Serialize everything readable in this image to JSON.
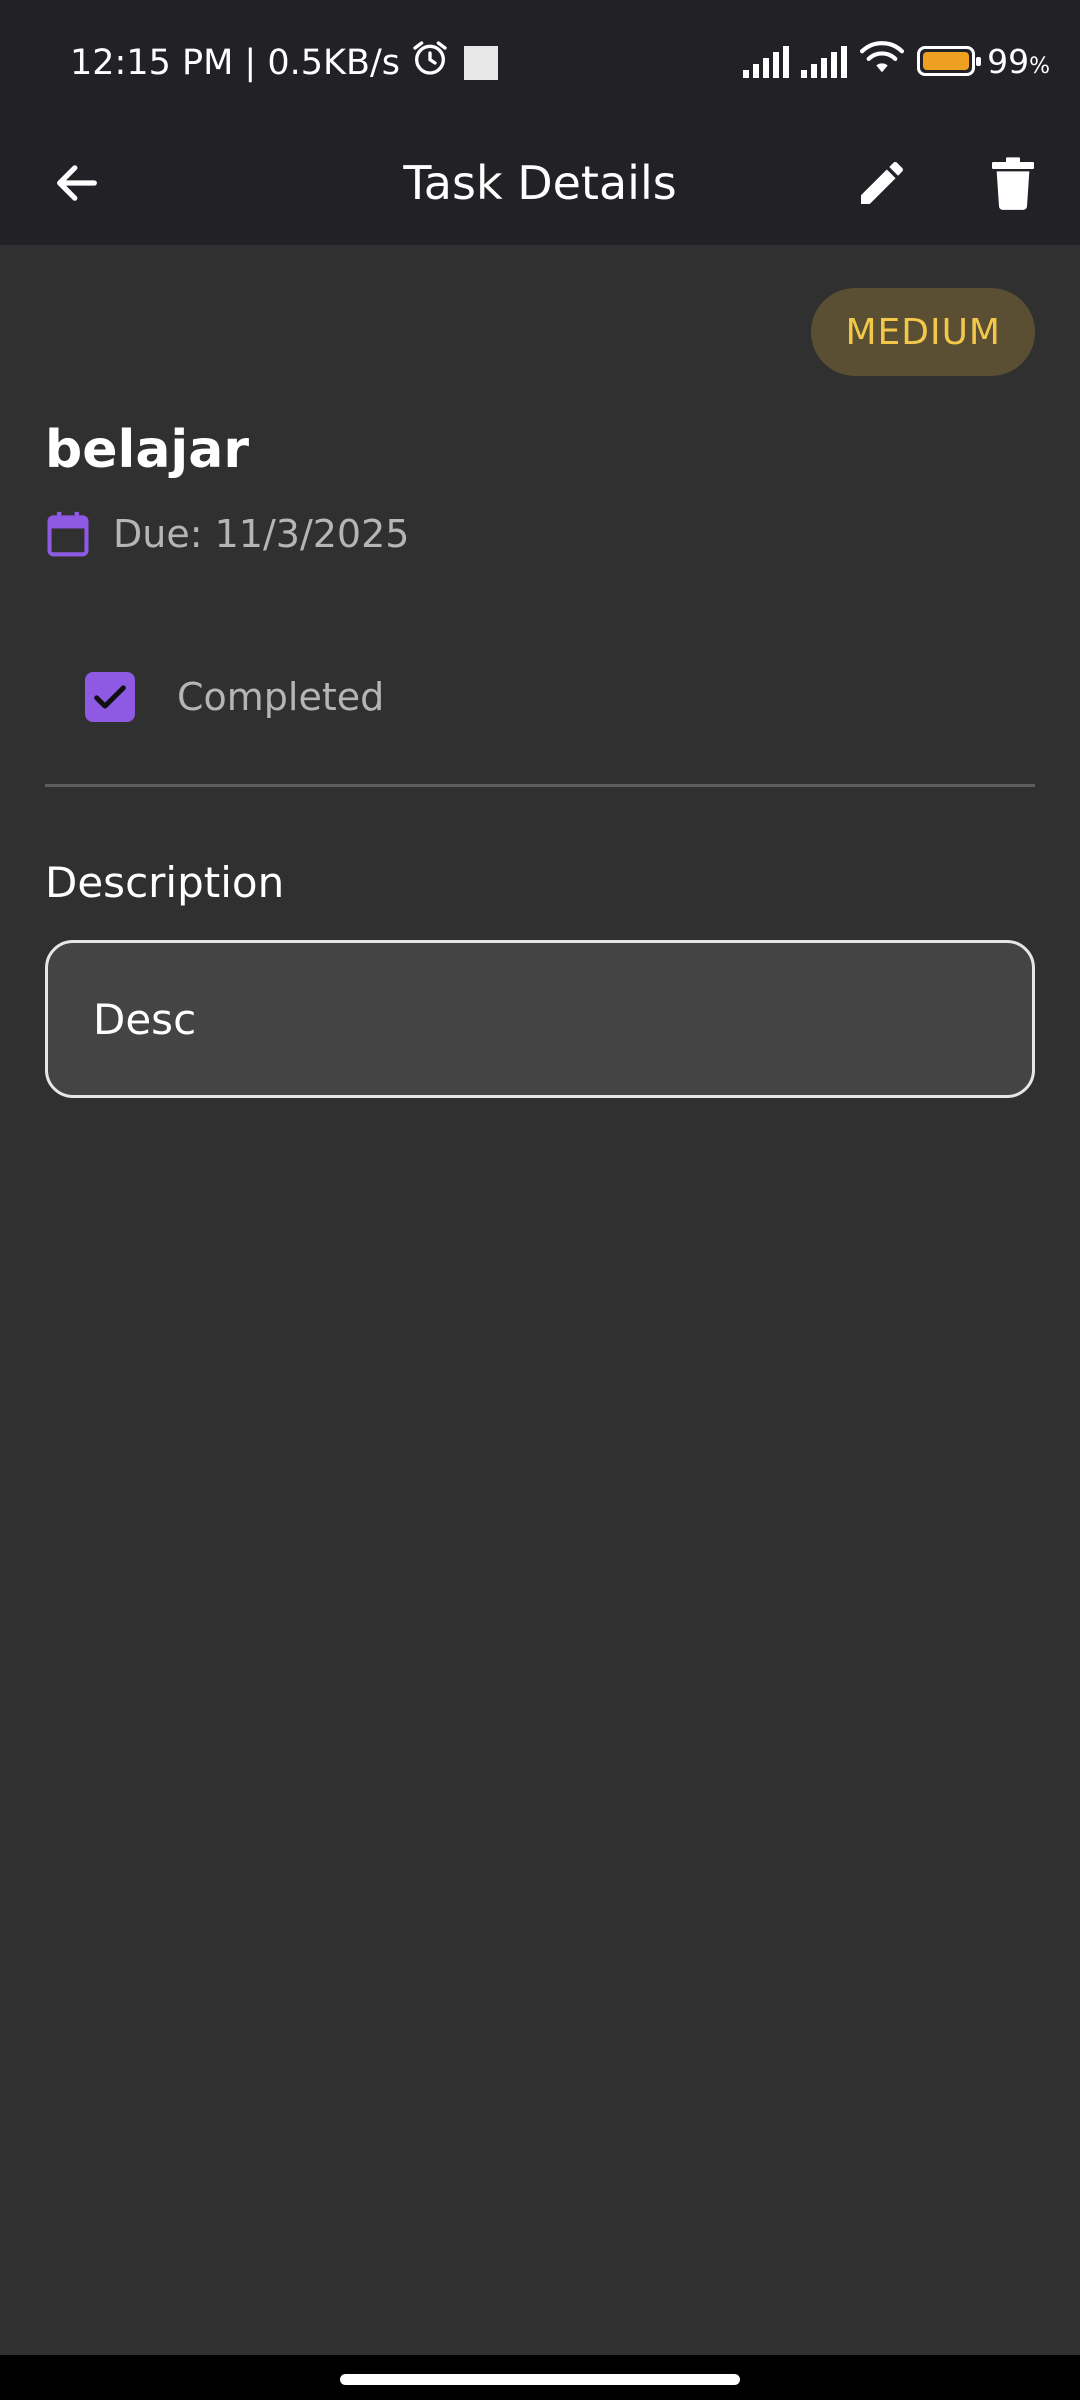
{
  "status_bar": {
    "time_speed": "12:15 PM | 0.5KB/s",
    "battery_percent": "99",
    "battery_pct_sign": "%",
    "battery_color": "#f0a020",
    "icons": [
      "alarm-icon",
      "stop-square-icon",
      "signal-icon",
      "signal-icon",
      "wifi-icon",
      "battery-icon"
    ]
  },
  "app_bar": {
    "title": "Task Details",
    "back_icon": "arrow-left-icon",
    "edit_icon": "pencil-icon",
    "delete_icon": "trash-icon"
  },
  "task": {
    "priority": "MEDIUM",
    "priority_color": "#f3c84a",
    "title": "belajar",
    "due": "Due: 11/3/2025",
    "completed_label": "Completed",
    "completed": true,
    "description_label": "Description",
    "description": "Desc"
  },
  "colors": {
    "accent": "#8e59e3",
    "background": "#303030",
    "app_bar": "#222226"
  }
}
